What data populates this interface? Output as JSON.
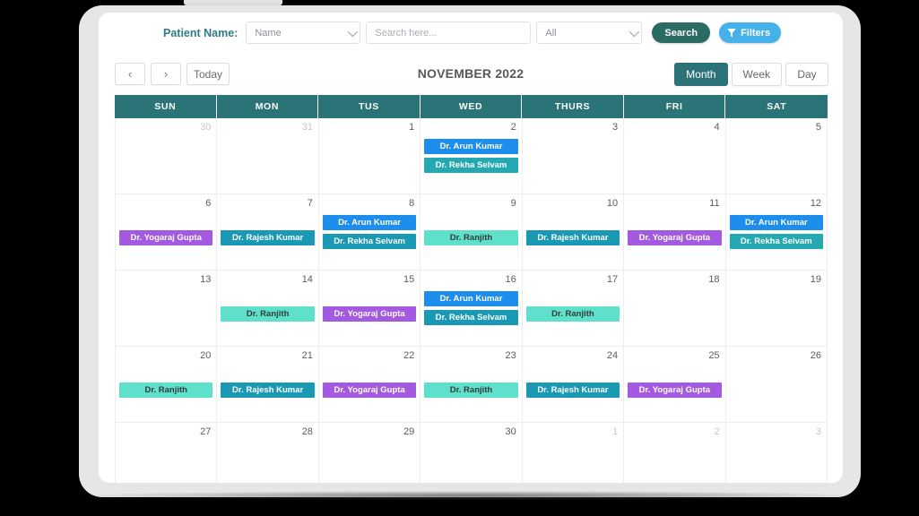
{
  "toolbar": {
    "patient_label": "Patient Name:",
    "name_select_value": "Name",
    "search_placeholder": "Search here...",
    "all_select_value": "All",
    "search_button": "Search",
    "filters_button": "Filters",
    "filter_icon": "funnel-icon"
  },
  "nav": {
    "prev_icon": "‹",
    "next_icon": "›",
    "today_label": "Today",
    "month_title": "NOVEMBER 2022",
    "views": [
      {
        "label": "Month",
        "active": true
      },
      {
        "label": "Week",
        "active": false
      },
      {
        "label": "Day",
        "active": false
      }
    ]
  },
  "calendar": {
    "weekday_headers": [
      "SUN",
      "MON",
      "TUS",
      "WED",
      "THURS",
      "FRI",
      "SAT"
    ],
    "colors": {
      "header_bg": "#2a7376",
      "active_view": "#2b7379",
      "search_btn": "#2a6b63",
      "filters_btn": "#45b1ea",
      "arun_kumar": "#1e8eee",
      "rekha_selvam": "#24a8b2",
      "rajesh_kumar": "#1999b3",
      "ranjith": "#5fe0cb",
      "yogaraj_gupta": "#a35ae0"
    },
    "weeks": [
      [
        {
          "day": "30",
          "muted": true,
          "events": []
        },
        {
          "day": "31",
          "muted": true,
          "events": []
        },
        {
          "day": "1",
          "muted": false,
          "events": []
        },
        {
          "day": "2",
          "muted": false,
          "events": [
            {
              "label": "Dr. Arun Kumar",
              "color": "blue"
            },
            {
              "label": "Dr. Rekha Selvam",
              "color": "teal"
            }
          ]
        },
        {
          "day": "3",
          "muted": false,
          "events": []
        },
        {
          "day": "4",
          "muted": false,
          "events": []
        },
        {
          "day": "5",
          "muted": false,
          "events": []
        }
      ],
      [
        {
          "day": "6",
          "muted": false,
          "offset": true,
          "events": [
            {
              "label": "Dr. Yogaraj Gupta",
              "color": "purple"
            }
          ]
        },
        {
          "day": "7",
          "muted": false,
          "offset": true,
          "events": [
            {
              "label": "Dr. Rajesh Kumar",
              "color": "dteal"
            }
          ]
        },
        {
          "day": "8",
          "muted": false,
          "events": [
            {
              "label": "Dr. Arun Kumar",
              "color": "blue"
            },
            {
              "label": "Dr. Rekha Selvam",
              "color": "dteal"
            }
          ]
        },
        {
          "day": "9",
          "muted": false,
          "offset": true,
          "events": [
            {
              "label": "Dr. Ranjith",
              "color": "mint"
            }
          ]
        },
        {
          "day": "10",
          "muted": false,
          "offset": true,
          "events": [
            {
              "label": "Dr. Rajesh Kumar",
              "color": "dteal"
            }
          ]
        },
        {
          "day": "11",
          "muted": false,
          "offset": true,
          "events": [
            {
              "label": "Dr. Yogaraj Gupta",
              "color": "purple"
            }
          ]
        },
        {
          "day": "12",
          "muted": false,
          "events": [
            {
              "label": "Dr. Arun Kumar",
              "color": "blue"
            },
            {
              "label": "Dr. Rekha Selvam",
              "color": "teal"
            }
          ]
        }
      ],
      [
        {
          "day": "13",
          "muted": false,
          "events": []
        },
        {
          "day": "14",
          "muted": false,
          "offset": true,
          "events": [
            {
              "label": "Dr. Ranjith",
              "color": "mint"
            }
          ]
        },
        {
          "day": "15",
          "muted": false,
          "offset": true,
          "events": [
            {
              "label": "Dr. Yogaraj Gupta",
              "color": "purple"
            }
          ]
        },
        {
          "day": "16",
          "muted": false,
          "events": [
            {
              "label": "Dr. Arun Kumar",
              "color": "blue"
            },
            {
              "label": "Dr. Rekha Selvam",
              "color": "dteal"
            }
          ]
        },
        {
          "day": "17",
          "muted": false,
          "offset": true,
          "events": [
            {
              "label": "Dr. Ranjith",
              "color": "mint"
            }
          ]
        },
        {
          "day": "18",
          "muted": false,
          "events": []
        },
        {
          "day": "19",
          "muted": false,
          "events": []
        }
      ],
      [
        {
          "day": "20",
          "muted": false,
          "offset": true,
          "events": [
            {
              "label": "Dr. Ranjith",
              "color": "mint"
            }
          ]
        },
        {
          "day": "21",
          "muted": false,
          "offset": true,
          "events": [
            {
              "label": "Dr. Rajesh Kumar",
              "color": "dteal"
            }
          ]
        },
        {
          "day": "22",
          "muted": false,
          "offset": true,
          "events": [
            {
              "label": "Dr. Yogaraj Gupta",
              "color": "purple"
            }
          ]
        },
        {
          "day": "23",
          "muted": false,
          "offset": true,
          "events": [
            {
              "label": "Dr. Ranjith",
              "color": "mint"
            }
          ]
        },
        {
          "day": "24",
          "muted": false,
          "offset": true,
          "events": [
            {
              "label": "Dr. Rajesh Kumar",
              "color": "dteal"
            }
          ]
        },
        {
          "day": "25",
          "muted": false,
          "offset": true,
          "events": [
            {
              "label": "Dr. Yogaraj Gupta",
              "color": "purple"
            }
          ]
        },
        {
          "day": "26",
          "muted": false,
          "events": []
        }
      ],
      [
        {
          "day": "27",
          "muted": false,
          "events": []
        },
        {
          "day": "28",
          "muted": false,
          "events": []
        },
        {
          "day": "29",
          "muted": false,
          "events": []
        },
        {
          "day": "30",
          "muted": false,
          "events": []
        },
        {
          "day": "1",
          "muted": true,
          "events": []
        },
        {
          "day": "2",
          "muted": true,
          "events": []
        },
        {
          "day": "3",
          "muted": true,
          "events": []
        }
      ]
    ]
  }
}
